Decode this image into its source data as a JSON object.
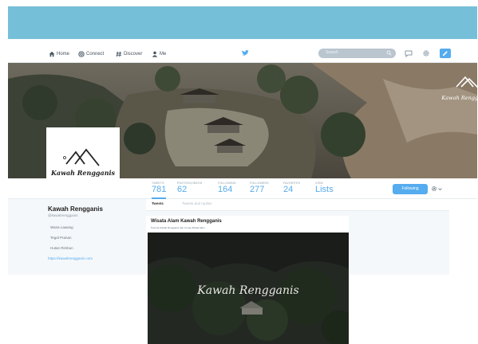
{
  "colors": {
    "banner": "#76bfd9",
    "accent": "#55acee",
    "panel": "#f5f8fa"
  },
  "nav": {
    "home": "Home",
    "connect": "Connect",
    "discover": "Discover",
    "me": "Me",
    "search_placeholder": "Search"
  },
  "cover": {
    "logo_text": "Kawah Rengganis"
  },
  "avatar": {
    "logo_text": "Kawah Rengganis"
  },
  "stats": [
    {
      "label": "TWEETS",
      "value": "781"
    },
    {
      "label": "PHOTOS/VIDEOS",
      "value": "62"
    },
    {
      "label": "FOLLOWING",
      "value": "164"
    },
    {
      "label": "FOLLOWERS",
      "value": "277"
    },
    {
      "label": "FAVORITES",
      "value": "24"
    },
    {
      "label": "VIEW",
      "value": "Lists"
    }
  ],
  "follow_button": "Following",
  "profile": {
    "name": "Kawah Rengganis",
    "handle": "@kawahrengganis",
    "lines": [
      "Wana Lawang",
      "Tegal Pranan",
      "Hutan Rimbun"
    ],
    "link": "https://kawahrengganis.com"
  },
  "tabs": {
    "tweets": "Tweets",
    "tweets_replies": "Tweets and replies"
  },
  "tweet": {
    "title": "Wisata Alam Kawah Rengganis",
    "subtitle": "Pesona Kawah Rengganis dan Curug Wisata Alam",
    "video_overlay": "Kawah Rengganis"
  }
}
